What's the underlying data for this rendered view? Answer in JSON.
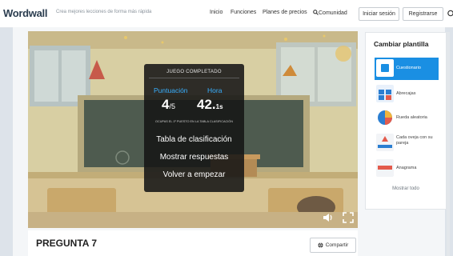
{
  "header": {
    "logo": "Wordwall",
    "tagline": "Crea mejores lecciones de forma más rápida",
    "nav": [
      "Inicio",
      "Funciones",
      "Planes de precios",
      "Comunidad"
    ],
    "login": "Iniciar sesión",
    "register": "Registrarse"
  },
  "result": {
    "title": "JUEGO COMPLETADO",
    "score_label": "Puntuación",
    "time_label": "Hora",
    "score": "4",
    "score_total": "/5",
    "time": "42.",
    "time_unit": "1s",
    "rank_text": "OCUPAS EL 1º PUESTO EN LA TABLA CLASIFICACIÓN",
    "leaderboard": "Tabla de clasificación",
    "show_answers": "Mostrar respuestas",
    "restart": "Volver a empezar"
  },
  "sidebar": {
    "title": "Cambiar plantilla",
    "templates": [
      {
        "label": "Cuestionario",
        "icon": "quiz-icon",
        "active": true
      },
      {
        "label": "Abrecajas",
        "icon": "boxes-icon",
        "active": false
      },
      {
        "label": "Rueda aleatoria",
        "icon": "wheel-icon",
        "active": false
      },
      {
        "label": "Cada oveja con su pareja",
        "icon": "match-icon",
        "active": false
      },
      {
        "label": "Anagrama",
        "icon": "anagram-icon",
        "active": false
      }
    ],
    "show_all": "Mostrar todo"
  },
  "footer": {
    "question_title": "PREGUNTA 7",
    "share": "Compartir"
  },
  "colors": {
    "accent": "#1a8fe3",
    "score_blue": "#38b0ff"
  }
}
